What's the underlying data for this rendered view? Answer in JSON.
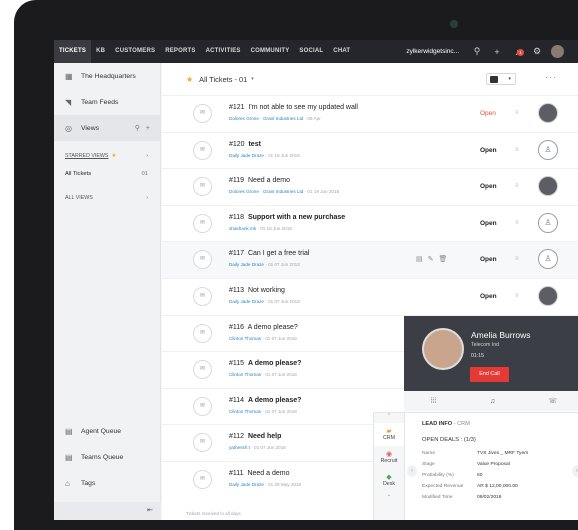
{
  "topbar": {
    "tabs": [
      "TICKETS",
      "KB",
      "CUSTOMERS",
      "REPORTS",
      "ACTIVITIES",
      "COMMUNITY",
      "SOCIAL",
      "CHAT"
    ],
    "org_name": "zylkerwidgetsinc...",
    "notification_count": "1"
  },
  "sidebar": {
    "department": "The Headquarters",
    "team_feeds": "Team Feeds",
    "views": "Views",
    "starred_views_label": "STARRED VIEWS",
    "all_tickets": "All Tickets",
    "all_tickets_count": "01",
    "all_views_label": "ALL VIEWS",
    "agent_queue": "Agent Queue",
    "teams_queue": "Teams Queue",
    "tags": "Tags"
  },
  "list": {
    "title": "All Tickets - 01",
    "footer": "Tickets received in all days",
    "rows": [
      {
        "id": "#121",
        "subject": "I'm not able to see my updated wall",
        "contact": "Dolores Grone",
        "account": "Grant Industries Ltd",
        "date": "06 Apr",
        "status": "Open",
        "bold": false,
        "red": true,
        "agent": "photo"
      },
      {
        "id": "#120",
        "subject": "test",
        "contact": "Daily Jade Draze",
        "account": "",
        "date": "01 19 Jun 2018",
        "status": "Open",
        "bold": true,
        "red": false,
        "agent": "empty"
      },
      {
        "id": "#119",
        "subject": "Need a demo",
        "contact": "Dolores Grone",
        "account": "Grant Industries Ltd",
        "date": "01 19 Jun 2018",
        "status": "Open",
        "bold": false,
        "red": false,
        "agent": "photo"
      },
      {
        "id": "#118",
        "subject": "Support with a new purchase",
        "contact": "shashank mk",
        "account": "",
        "date": "01 18 Jun 2018",
        "status": "Open",
        "bold": true,
        "red": false,
        "agent": "empty"
      },
      {
        "id": "#117",
        "subject": "Can I get a free trial",
        "contact": "Daily Jade Draze",
        "account": "",
        "date": "01 07 Jun 2018",
        "status": "Open",
        "bold": false,
        "red": false,
        "agent": "empty"
      },
      {
        "id": "#113",
        "subject": "Not working",
        "contact": "Daily Jade Draze",
        "account": "",
        "date": "01 07 Jun 2018",
        "status": "Open",
        "bold": false,
        "red": false,
        "agent": "photo"
      },
      {
        "id": "#116",
        "subject": "A demo please?",
        "contact": "Clinton Thomas",
        "account": "",
        "date": "01 07 Jun 2018",
        "status": "",
        "bold": false,
        "red": false,
        "agent": ""
      },
      {
        "id": "#115",
        "subject": "A demo please?",
        "contact": "Clinton Thomas",
        "account": "",
        "date": "01 07 Jun 2018",
        "status": "",
        "bold": true,
        "red": false,
        "agent": ""
      },
      {
        "id": "#114",
        "subject": "A demo please?",
        "contact": "Clinton Thomas",
        "account": "",
        "date": "01 07 Jun 2018",
        "status": "",
        "bold": true,
        "red": false,
        "agent": ""
      },
      {
        "id": "#112",
        "subject": "Need help",
        "contact": "yathessh t",
        "account": "",
        "date": "01 07 Jun 2018",
        "status": "",
        "bold": true,
        "red": false,
        "agent": ""
      },
      {
        "id": "#111",
        "subject": "Need a demo",
        "contact": "Daily Jade Draze",
        "account": "",
        "date": "01 29 May 2018",
        "status": "",
        "bold": false,
        "red": false,
        "agent": ""
      }
    ]
  },
  "call": {
    "name": "Amelia Burrows",
    "company": "Telecom Ind",
    "timer": "01:15",
    "end_label": "End Call"
  },
  "crm": {
    "rail": [
      "CRM",
      "Recruit",
      "Desk"
    ],
    "header": "LEAD INFO",
    "header_source": "- CRM",
    "deals_title": "OPEN DEALS : (1/3)",
    "fields": [
      {
        "k": "Name",
        "v": "TVS Jives _ MRF Tyers"
      },
      {
        "k": "Stage",
        "v": "Value Proposal"
      },
      {
        "k": "Probability (%)",
        "v": "60"
      },
      {
        "k": "Expected Revenue",
        "v": "AR $ 12,00,000.00"
      },
      {
        "k": "Modified Time",
        "v": "09/02/2018"
      }
    ]
  }
}
